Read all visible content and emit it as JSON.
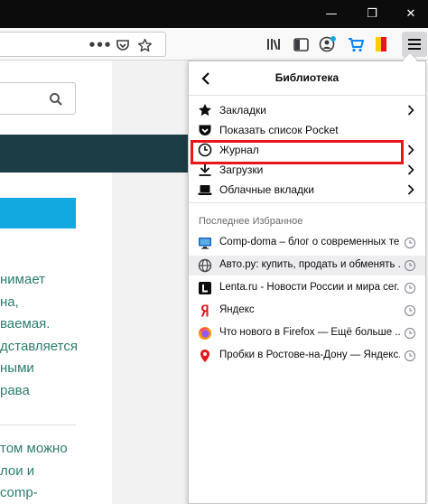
{
  "window": {
    "minimize_glyph": "—",
    "maximize_glyph": "❐",
    "close_glyph": "✕"
  },
  "toolbar": {
    "overflow_glyph": "•••",
    "icons": [
      "library-icon",
      "sidebar-icon",
      "account-icon",
      "cart-icon",
      "flag-icon",
      "menu-icon"
    ]
  },
  "page": {
    "lines_1": [
      "нимает",
      "на,",
      "ваемая.",
      "дставляется",
      "ными",
      "рава"
    ],
    "lines_2": [
      "том можно",
      "лои и",
      "comp-"
    ],
    "colors": {
      "dark_band": "#1c3d45",
      "accent": "#12a8e0",
      "text": "#2e7d6f"
    }
  },
  "panel": {
    "title": "Библиотека",
    "items": [
      {
        "label": "Закладки",
        "icon": "star-icon",
        "has_submenu": true
      },
      {
        "label": "Показать список Pocket",
        "icon": "pocket-icon",
        "has_submenu": false
      },
      {
        "label": "Журнал",
        "icon": "clock-icon",
        "has_submenu": true,
        "highlighted": true
      },
      {
        "label": "Загрузки",
        "icon": "download-icon",
        "has_submenu": true
      },
      {
        "label": "Облачные вкладки",
        "icon": "synced-tabs-icon",
        "has_submenu": true
      }
    ],
    "recent_section_title": "Последнее Избранное",
    "recent": [
      {
        "label": "Comp-doma – блог о современных те...",
        "icon": "monitor-favicon"
      },
      {
        "label": "Авто.ру: купить, продать и обменять ...",
        "icon": "globe-favicon",
        "selected": true
      },
      {
        "label": "Lenta.ru - Новости России и мира сег...",
        "icon": "lenta-favicon"
      },
      {
        "label": "Яндекс",
        "icon": "yandex-favicon"
      },
      {
        "label": "Что нового в Firefox — Ещё больше ...",
        "icon": "firefox-favicon"
      },
      {
        "label": "Пробки в Ростове-на-Дону — Яндекс....",
        "icon": "maps-pin-favicon"
      }
    ],
    "highlight_color": "#e8151b"
  }
}
